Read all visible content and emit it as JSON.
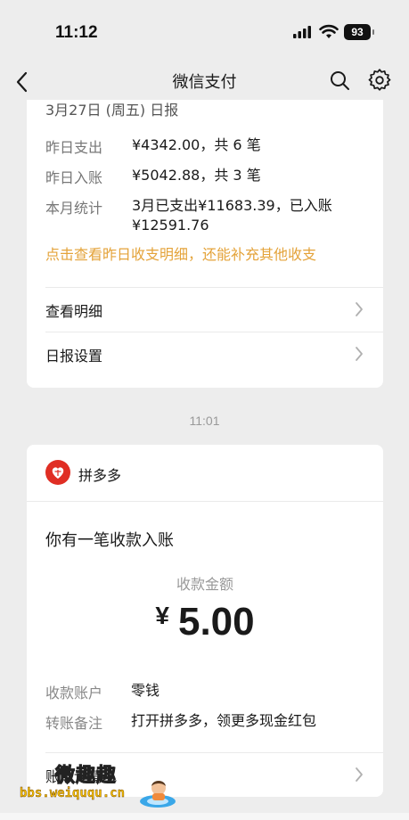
{
  "status_bar": {
    "time": "11:12",
    "battery": "93"
  },
  "nav": {
    "title": "微信支付",
    "icons": [
      "back-chevron-icon",
      "search-icon",
      "gear-icon"
    ]
  },
  "report_card": {
    "header": "3月27日 (周五) 日报",
    "rows": [
      {
        "label": "昨日支出",
        "value": "¥4342.00，共 6 笔"
      },
      {
        "label": "昨日入账",
        "value": "¥5042.88，共 3 笔"
      },
      {
        "label": "本月统计",
        "value": "3月已支出¥11683.39，已入账¥12591.76"
      }
    ],
    "tip": "点击查看昨日收支明细，还能补充其他收支",
    "links": [
      {
        "label": "查看明细"
      },
      {
        "label": "日报设置"
      }
    ]
  },
  "timestamp": "11:01",
  "payment_card": {
    "merchant": "拼多多",
    "title": "你有一笔收款入账",
    "amount_label": "收款金额",
    "currency": "¥",
    "amount": "5.00",
    "rows": [
      {
        "label": "收款账户",
        "value": "零钱"
      },
      {
        "label": "转账备注",
        "value": "打开拼多多，领更多现金红包"
      }
    ],
    "link": "账单详情"
  },
  "watermark": {
    "name": "微趣趣",
    "url": "bbs.weiququ.cn"
  },
  "colors": {
    "tip": "#e4a33a",
    "merchant_logo": "#e02e24",
    "background": "#ededed"
  }
}
